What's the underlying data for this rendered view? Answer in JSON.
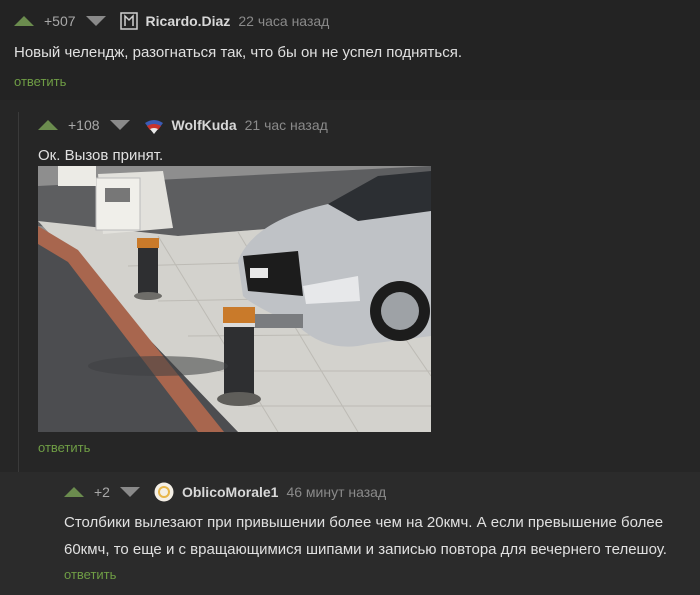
{
  "comments": [
    {
      "rating": "+507",
      "author": "Ricardo.Diaz",
      "time": "22 часа назад",
      "text": "Новый челендж, разогнаться так, что бы он не успел подняться.",
      "reply": "ответить"
    },
    {
      "rating": "+108",
      "author": "WolfKuda",
      "time": "21 час назад",
      "text": "Ок. Вызов принят.",
      "reply": "ответить"
    },
    {
      "rating": "+2",
      "author": "OblicoMorale1",
      "time": "46 минут назад",
      "text_line1": "Столбики вылезают при привышении более чем на 20кмч. А если превышение более",
      "text_line2": "60кмч, то еще и с вращающимися шипами и записью повтора для вечернего телешоу.",
      "reply": "ответить"
    }
  ],
  "icons": {
    "upvote": "arrow-up-icon",
    "downvote": "arrow-down-icon"
  },
  "colors": {
    "upvote": "#6b8c4e",
    "reply": "#6f9d45",
    "background": "#232323"
  }
}
